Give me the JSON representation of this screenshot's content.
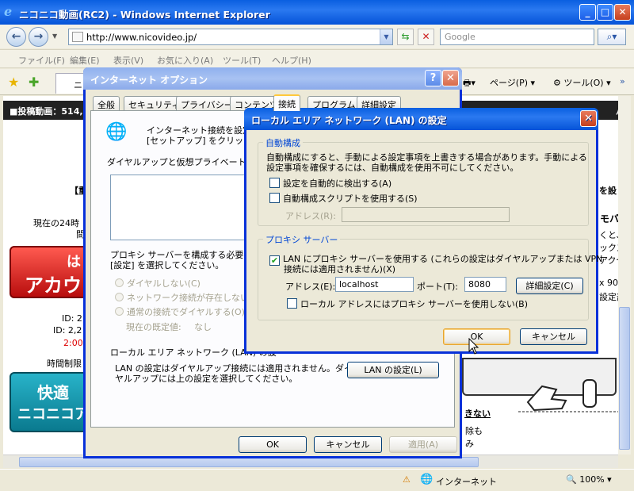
{
  "browser": {
    "title": "ニコニコ動画(RC2) - Windows Internet Explorer",
    "url": "http://www.nicovideo.jp/",
    "search_placeholder": "Google",
    "menu": [
      "ファイル(F)",
      "編集(E)",
      "表示(V)",
      "お気に入り(A)",
      "ツール(T)",
      "ヘルプ(H)"
    ],
    "tab_label": "ニ",
    "toolbar": {
      "page": "ページ(P)",
      "tools": "ツール(O)"
    },
    "status": {
      "zone": "インターネット",
      "zoom": "100%"
    }
  },
  "nico": {
    "bar_text": "投稿動画：514,3",
    "bar_right": "パ",
    "bracket": "【重",
    "right_line": "を設",
    "line1": "現在の24時",
    "line2": "間",
    "red_btn_small": "は",
    "red_btn": "アカウ",
    "id1": "ID: 2",
    "id2": "ID: 2,2",
    "time_red": "2:00",
    "limit": "時間制限",
    "blue_btn_line1": "快適",
    "blue_btn_line2": "ニコニコア",
    "right_mo": "モバ",
    "right_1": "くと、",
    "right_2": "ックス",
    "right_3": "アクセ",
    "right_4": "x 90",
    "right_5": "設定部",
    "right_nai": "きない",
    "right_jo": "除も",
    "right_mi": "み"
  },
  "internet_options": {
    "title": "インターネット オプション",
    "tabs": [
      "全般",
      "セキュリティ",
      "プライバシー",
      "コンテンツ",
      "接続",
      "プログラム",
      "詳細設定"
    ],
    "setup_text_1": "インターネット接続を設定す",
    "setup_text_2": "[セットアップ] をクリックしてく",
    "dialup_label": "ダイヤルアップと仮想プライベート ネット",
    "proxy_text_1": "プロキシ サーバーを構成する必要があ",
    "proxy_text_2": "[設定] を選択してください。",
    "radio_1": "ダイヤルしない(C)",
    "radio_2": "ネットワーク接続が存在しないとき",
    "radio_3": "通常の接続でダイヤルする(O)",
    "default_label": "現在の既定値:",
    "default_value": "なし",
    "lan_section": "ローカル エリア ネットワーク (LAN) の設",
    "lan_text_1": "LAN の設定はダイヤルアップ接続には適用されません。ダイ",
    "lan_text_2": "ヤルアップには上の設定を選択してください。",
    "lan_button": "LAN の設定(L)",
    "ok": "OK",
    "cancel": "キャンセル",
    "apply": "適用(A)"
  },
  "lan_settings": {
    "title": "ローカル エリア ネットワーク (LAN) の設定",
    "auto_group": "自動構成",
    "auto_desc_1": "自動構成にすると、手動による設定事項を上書きする場合があります。手動による",
    "auto_desc_2": "設定事項を確保するには、自動構成を使用不可にしてください。",
    "auto_detect": "設定を自動的に検出する(A)",
    "auto_script": "自動構成スクリプトを使用する(S)",
    "address_label_disabled": "アドレス(R):",
    "proxy_group": "プロキシ サーバー",
    "use_proxy_1": "LAN にプロキシ サーバーを使用する (これらの設定はダイヤルアップまたは VPN",
    "use_proxy_2": "接続には適用されません)(X)",
    "address_label": "アドレス(E):",
    "address_value": "localhost",
    "port_label": "ポート(T):",
    "port_value": "8080",
    "advanced": "詳細設定(C)",
    "bypass_local": "ローカル アドレスにはプロキシ サーバーを使用しない(B)",
    "ok": "OK",
    "cancel": "キャンセル"
  }
}
